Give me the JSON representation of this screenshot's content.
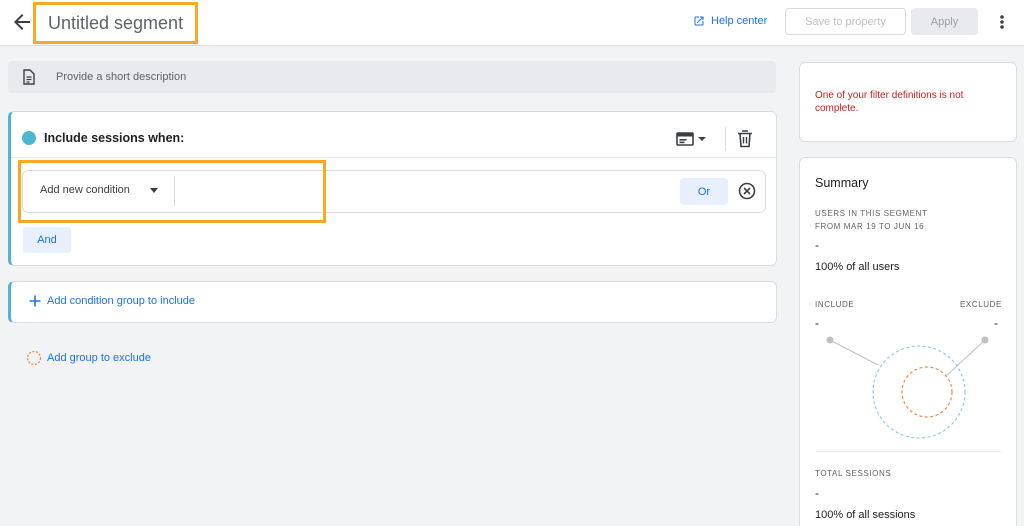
{
  "header": {
    "title": "Untitled segment",
    "help_label": "Help center",
    "save_label": "Save to property",
    "apply_label": "Apply"
  },
  "description": {
    "placeholder": "Provide a short description"
  },
  "include_group": {
    "title": "Include sessions when:",
    "condition_placeholder": "Add new condition",
    "or_label": "Or",
    "and_label": "And"
  },
  "add_include_group_label": "Add condition group to include",
  "add_exclude_group_label": "Add group to exclude",
  "error": {
    "message": "One of your filter definitions is not complete."
  },
  "summary": {
    "title": "Summary",
    "users_label_line1": "USERS IN THIS SEGMENT",
    "users_label_line2": "FROM MAR 19 TO JUN 16",
    "users_value": "-",
    "users_pct": "100% of all users",
    "include_label": "INCLUDE",
    "exclude_label": "EXCLUDE",
    "include_value": "-",
    "exclude_value": "-",
    "sessions_label": "TOTAL SESSIONS",
    "sessions_value": "-",
    "sessions_pct": "100% of all sessions"
  },
  "colors": {
    "accent": "#1a73e8",
    "include": "#4fb6d0",
    "exclude": "#f28b45",
    "highlight": "#f9a825",
    "error": "#c5221f"
  },
  "icons": {
    "back": "arrow-back-icon",
    "help": "open-in-new-icon",
    "more": "more-vert-icon",
    "description": "document-icon",
    "scope": "card-scope-icon",
    "delete": "trash-icon",
    "remove": "close-circle-icon",
    "add": "plus-icon",
    "exclude": "dashed-circle-icon"
  }
}
